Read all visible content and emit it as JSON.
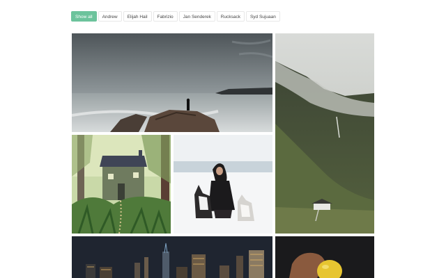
{
  "filters": {
    "items": [
      {
        "label": "Show all",
        "active": true
      },
      {
        "label": "Andrew",
        "active": false
      },
      {
        "label": "Elijah Hail",
        "active": false
      },
      {
        "label": "Fabrizio",
        "active": false
      },
      {
        "label": "Jan Senderek",
        "active": false
      },
      {
        "label": "Rucksack",
        "active": false
      },
      {
        "label": "Syd Sujuaan",
        "active": false
      }
    ]
  },
  "gallery": {
    "accent_color": "#6cc39c",
    "photos": [
      {
        "subject": "seascape-rock-figure"
      },
      {
        "subject": "misty-mountain-valley"
      },
      {
        "subject": "illustrated-house-forest"
      },
      {
        "subject": "woman-with-huskies-snow"
      },
      {
        "subject": "city-skyline-night"
      },
      {
        "subject": "hand-holding-lemon"
      }
    ]
  }
}
